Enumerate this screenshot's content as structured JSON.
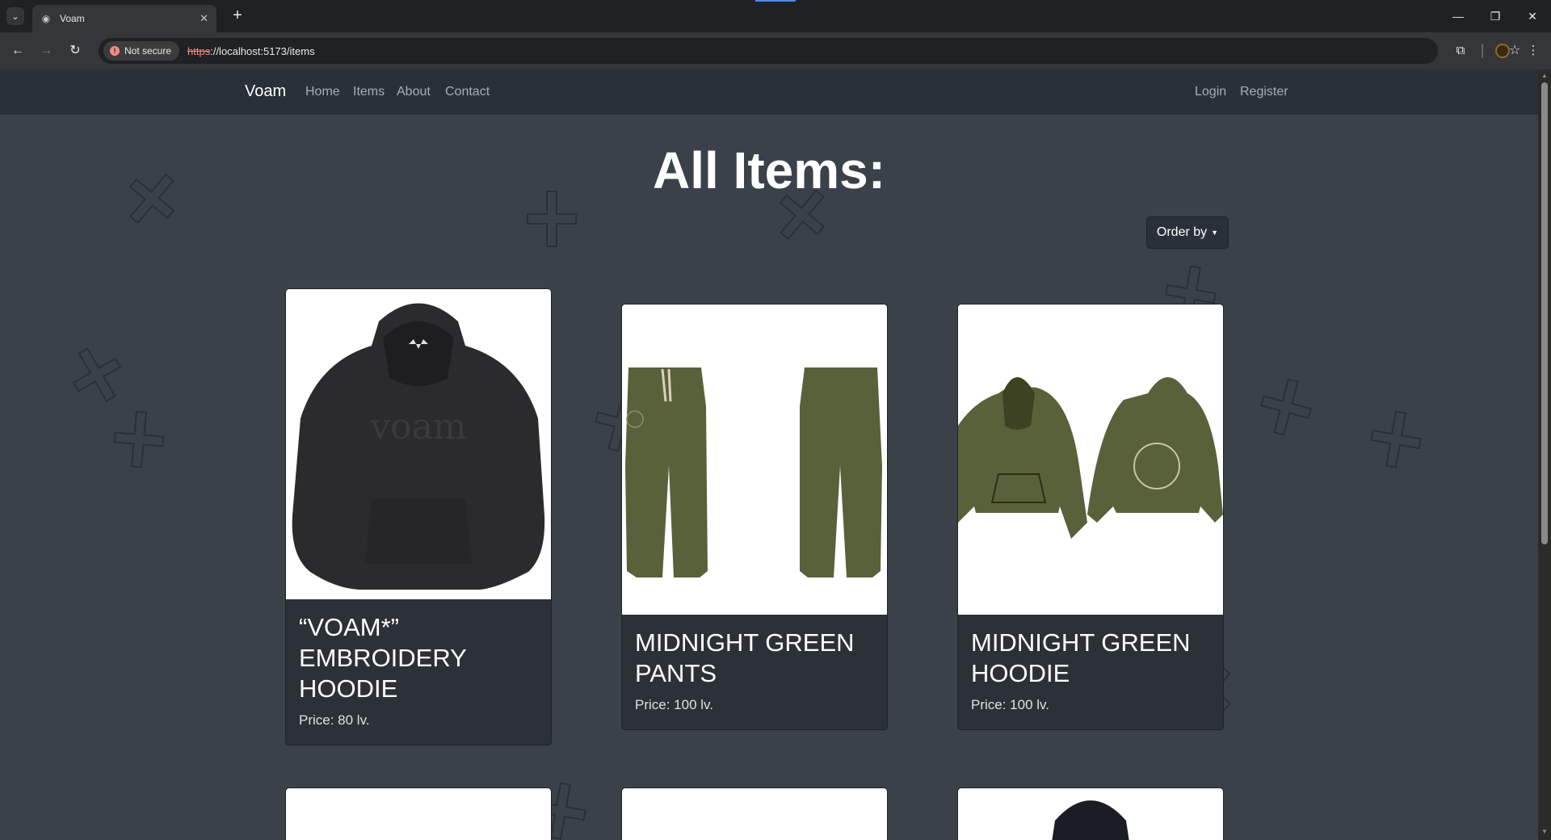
{
  "browser": {
    "tab_title": "Voam",
    "security_label": "Not secure",
    "url_scheme": "https",
    "url_rest": "://localhost:5173/items"
  },
  "site": {
    "brand": "Voam",
    "nav_left": [
      "Home",
      "Items",
      "About",
      "Contact"
    ],
    "nav_right": [
      "Login",
      "Register"
    ]
  },
  "main": {
    "heading": "All Items:",
    "order_by_label": "Order by"
  },
  "items": [
    {
      "name": "“VOAM*” EMBROIDERY HOODIE",
      "price": "Price: 80 lv.",
      "image": "black-hoodie"
    },
    {
      "name": "MIDNIGHT GREEN PANTS",
      "price": "Price: 100 lv.",
      "image": "green-pants"
    },
    {
      "name": "MIDNIGHT GREEN HOODIE",
      "price": "Price: 100 lv.",
      "image": "green-hoodie"
    }
  ],
  "colors": {
    "page_bg": "#3a4149",
    "navbar_bg": "#2a3038",
    "card_body_bg": "#2c3138",
    "olive": "#59613a",
    "hoodie_black": "#2a2a2c"
  }
}
